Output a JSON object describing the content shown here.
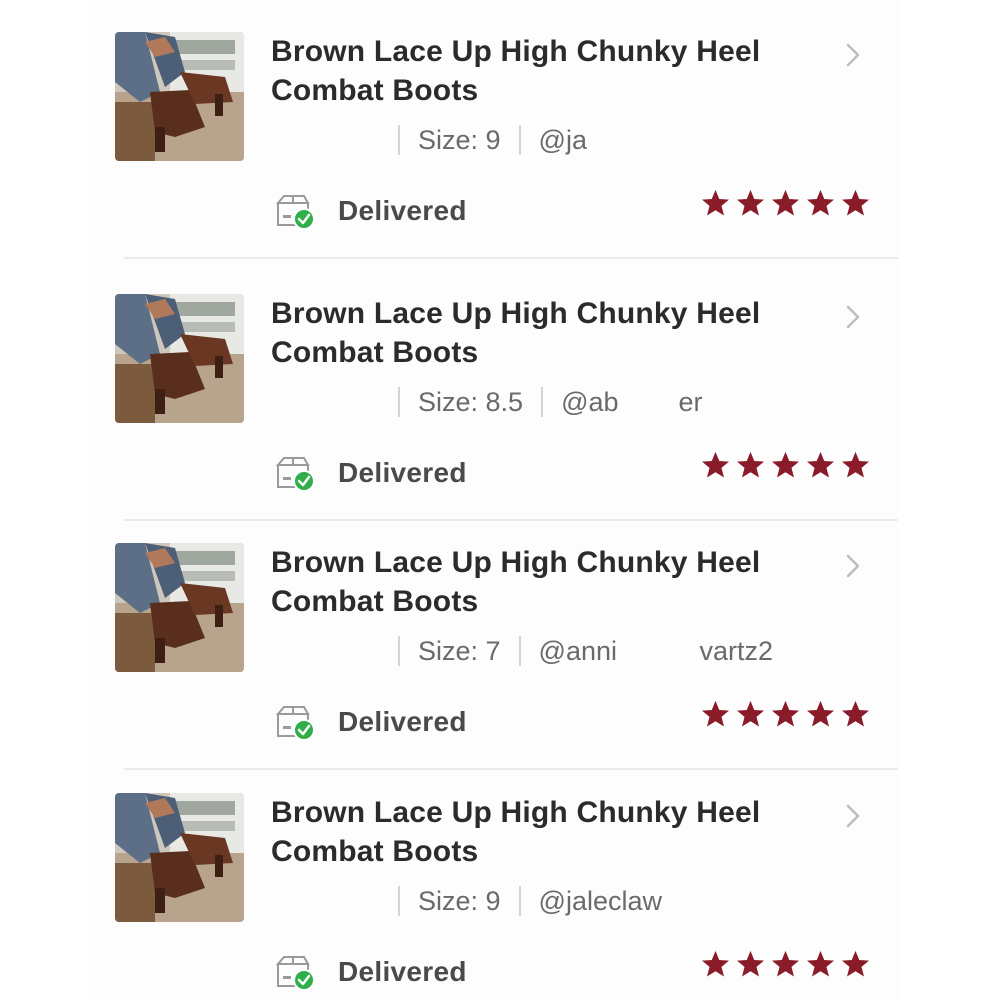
{
  "orders": [
    {
      "title_line1": "Brown Lace Up High Chunky Heel",
      "title_line2": "Combat Boots",
      "size": "Size: 9",
      "seller": "@ja",
      "status": "Delivered",
      "rating": 5
    },
    {
      "title_line1": "Brown Lace Up High Chunky Heel",
      "title_line2": "Combat Boots",
      "size": "Size: 8.5",
      "seller": "@ab        er",
      "status": "Delivered",
      "rating": 5
    },
    {
      "title_line1": "Brown Lace Up High Chunky Heel",
      "title_line2": "Combat Boots",
      "size": "Size: 7",
      "seller": "@anni           vartz2",
      "status": "Delivered",
      "rating": 5
    },
    {
      "title_line1": "Brown Lace Up High Chunky Heel",
      "title_line2": "Combat Boots",
      "size": "Size: 9",
      "seller": "@jaleclaw",
      "status": "Delivered",
      "rating": 5
    }
  ],
  "colors": {
    "star": "#8a1c2a",
    "check": "#2fae4a",
    "title": "#2b2b2b",
    "meta": "#6a6a6a"
  },
  "icons": {
    "chevron": "chevron-right-icon",
    "delivered": "delivered-box-check-icon",
    "star": "star-icon"
  }
}
